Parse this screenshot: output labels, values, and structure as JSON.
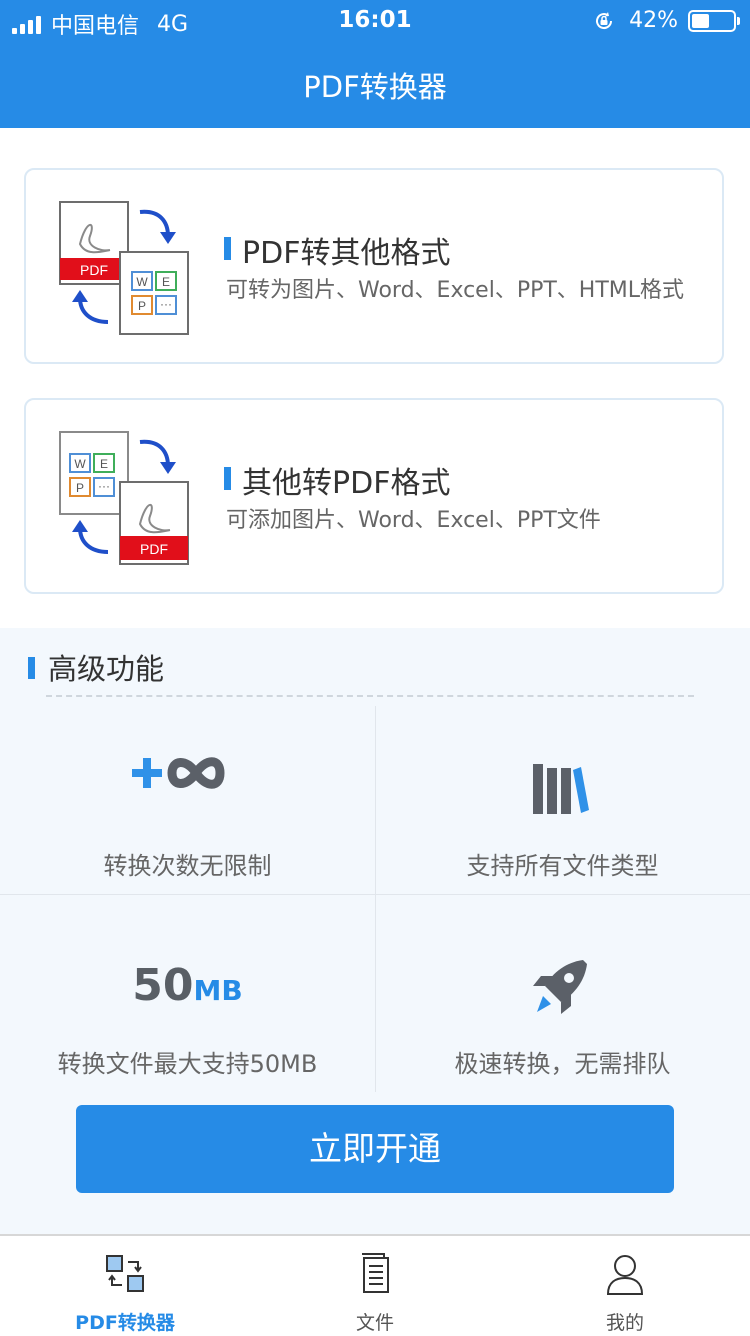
{
  "status": {
    "carrier": "中国电信",
    "network": "4G",
    "time": "16:01",
    "battery": "42%"
  },
  "header": {
    "title": "PDF转换器"
  },
  "cards": [
    {
      "title": "PDF转其他格式",
      "desc": "可转为图片、Word、Excel、PPT、HTML格式",
      "badge": "PDF"
    },
    {
      "title": "其他转PDF格式",
      "desc": "可添加图片、Word、Excel、PPT文件",
      "badge": "PDF"
    }
  ],
  "advanced": {
    "title": "高级功能",
    "features": [
      {
        "label": "转换次数无限制",
        "icon": "unlimited-icon"
      },
      {
        "label": "支持所有文件类型",
        "icon": "library-icon"
      },
      {
        "label": "转换文件最大支持50MB",
        "icon": "size-icon",
        "big_number": "50",
        "big_unit": "MB"
      },
      {
        "label": "极速转换，无需排队",
        "icon": "rocket-icon"
      }
    ],
    "button": "立即开通"
  },
  "tabs": [
    {
      "label": "PDF转换器",
      "active": true
    },
    {
      "label": "文件",
      "active": false
    },
    {
      "label": "我的",
      "active": false
    }
  ],
  "colors": {
    "accent": "#268be6",
    "pdf_red": "#e10f1a"
  }
}
